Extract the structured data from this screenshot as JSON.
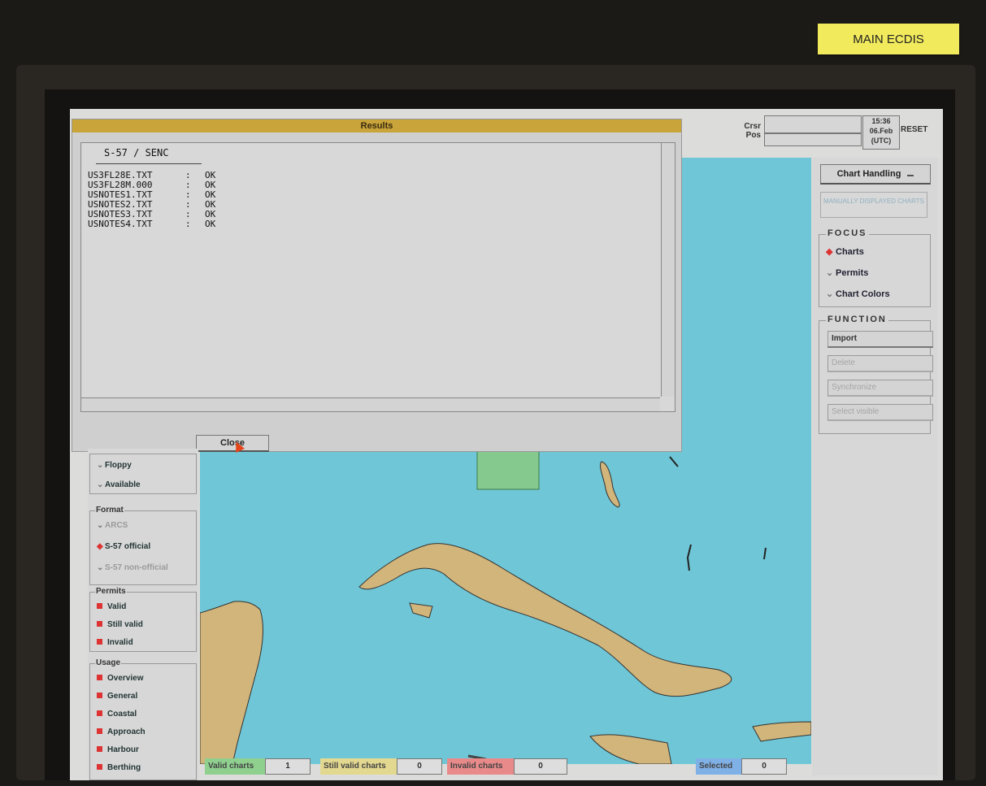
{
  "sticker": "MAIN ECDIS",
  "results": {
    "title": "Results",
    "heading": "S-57 / SENC",
    "lines": [
      {
        "file": "US3FL28E.TXT",
        "sep": ":",
        "status": "OK"
      },
      {
        "file": "US3FL28M.000",
        "sep": ":",
        "status": "OK"
      },
      {
        "file": "USNOTES1.TXT",
        "sep": ":",
        "status": "OK"
      },
      {
        "file": "USNOTES2.TXT",
        "sep": ":",
        "status": "OK"
      },
      {
        "file": "USNOTES3.TXT",
        "sep": ":",
        "status": "OK"
      },
      {
        "file": "USNOTES4.TXT",
        "sep": ":",
        "status": "OK"
      }
    ],
    "close_label": "Close"
  },
  "top": {
    "crsr_label": "Crsr",
    "pos_label": "Pos",
    "time": "15:36",
    "date": "06.Feb",
    "tz": "(UTC)",
    "reset_label": "RESET"
  },
  "right_panel": {
    "chart_handling": "Chart Handling",
    "dim_button": "MANUALLY DISPLAYED CHARTS",
    "focus": {
      "title": "FOCUS",
      "options": [
        "Charts",
        "Permits",
        "Chart Colors"
      ],
      "selected": "Charts"
    },
    "function": {
      "title": "FUNCTION",
      "buttons": [
        "Import",
        "Delete",
        "Synchronize",
        "Select visible"
      ]
    }
  },
  "left_panel": {
    "source": [
      "Floppy",
      "Available"
    ],
    "format": {
      "title": "Format",
      "options": [
        "ARCS",
        "S-57 official",
        "S-57 non-official"
      ],
      "selected": "S-57 official"
    },
    "permits": {
      "title": "Permits",
      "items": [
        "Valid",
        "Still valid",
        "Invalid"
      ]
    },
    "usage": {
      "title": "Usage",
      "items": [
        "Overview",
        "General",
        "Coastal",
        "Approach",
        "Harbour",
        "Berthing"
      ]
    }
  },
  "status_bar": {
    "valid_label": "Valid charts",
    "valid_count": "1",
    "still_label": "Still valid charts",
    "still_count": "0",
    "invalid_label": "Invalid charts",
    "invalid_count": "0",
    "selected_label": "Selected",
    "selected_count": "0",
    "colors": {
      "valid": "#8fd08f",
      "still": "#e3d890",
      "invalid": "#e98a8a",
      "selected": "#7fb0e6"
    }
  },
  "colors": {
    "sea": "#6fc6d6",
    "land": "#d2b57a",
    "title_bar": "#c8a43a",
    "chart_box": "#86c98e"
  }
}
